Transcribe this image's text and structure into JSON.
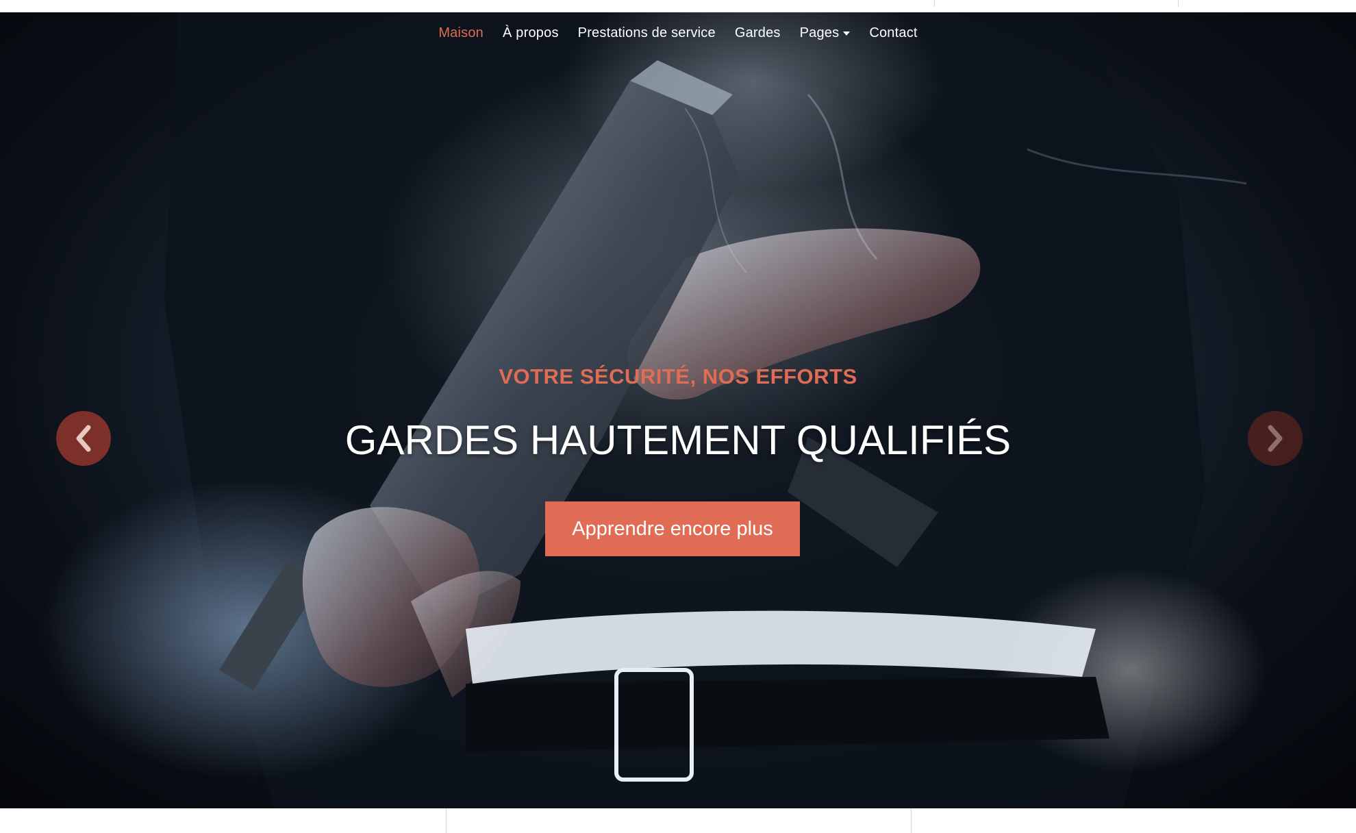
{
  "nav": {
    "items": [
      {
        "label": "Maison",
        "active": true
      },
      {
        "label": "À propos",
        "active": false
      },
      {
        "label": "Prestations de service",
        "active": false
      },
      {
        "label": "Gardes",
        "active": false
      },
      {
        "label": "Pages",
        "active": false,
        "dropdown": true
      },
      {
        "label": "Contact",
        "active": false
      }
    ]
  },
  "hero": {
    "eyebrow": "VOTRE SÉCURITÉ, NOS EFFORTS",
    "headline": "GARDES HAUTEMENT QUALIFIÉS",
    "cta_label": "Apprendre encore plus",
    "prev_icon": "chevron-left-icon",
    "next_icon": "chevron-right-icon"
  },
  "colors": {
    "accent": "#e06c55",
    "text_light": "#ffffff",
    "hero_dark": "#0b1018"
  }
}
